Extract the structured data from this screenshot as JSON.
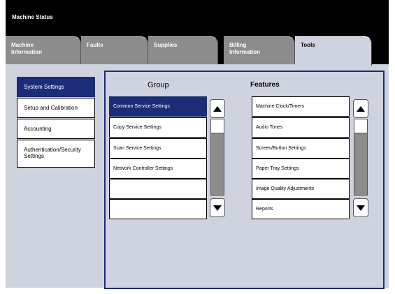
{
  "header": {
    "title": "Machine Status"
  },
  "tabs": [
    {
      "label": "Machine\nInformation"
    },
    {
      "label": "Faults"
    },
    {
      "label": "Supplies"
    },
    {
      "label": "Billing\nInformation"
    },
    {
      "label": "Tools"
    }
  ],
  "nav": {
    "items": [
      {
        "label": "System Settings",
        "selected": true
      },
      {
        "label": "Setup and Calibration"
      },
      {
        "label": "Accounting"
      },
      {
        "label": "Authentication/Security Settings"
      }
    ]
  },
  "group": {
    "heading": "Group",
    "items": [
      {
        "label": "Common Service Settings",
        "selected": true
      },
      {
        "label": "Copy Service Settings"
      },
      {
        "label": "Scan Service Settings"
      },
      {
        "label": "Network Controller Settings"
      },
      {
        "label": ""
      },
      {
        "label": ""
      }
    ]
  },
  "features": {
    "heading": "Features",
    "items": [
      {
        "label": "Machine Clock/Timers"
      },
      {
        "label": "Audio Tones"
      },
      {
        "label": "Screen/Button Settings"
      },
      {
        "label": "Paper Tray Settings"
      },
      {
        "label": "Image Quality Adjustments"
      },
      {
        "label": "Reports"
      }
    ]
  },
  "icons": {
    "scroll_up": "triangle-up-icon",
    "scroll_down": "triangle-down-icon"
  },
  "colors": {
    "selected": "#1c2c78",
    "panel": "#cfd3df",
    "tab_inactive": "#8c8c8c",
    "header": "#000000"
  }
}
